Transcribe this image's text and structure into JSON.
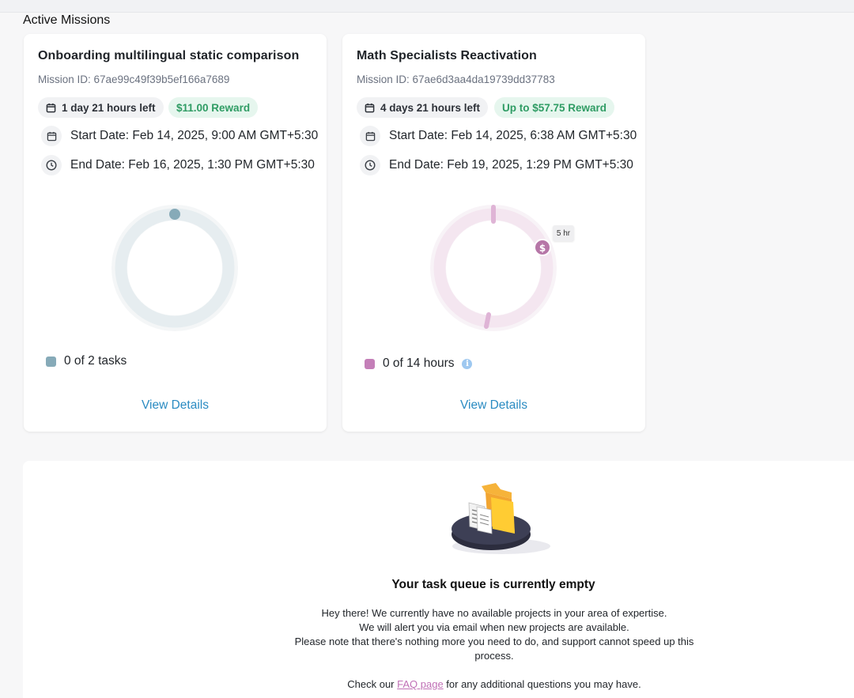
{
  "section_title": "Active Missions",
  "missions": [
    {
      "title": "Onboarding multilingual static comparison",
      "mission_id": "Mission ID: 67ae99c49f39b5ef166a7689",
      "time_left": "1 day 21 hours left",
      "reward": "$11.00 Reward",
      "start_date": "Start Date: Feb 14, 2025, 9:00 AM GMT+5:30",
      "end_date": "End Date: Feb 16, 2025, 1:30 PM GMT+5:30",
      "progress_label": "0 of 2 tasks",
      "progress_fraction": 0,
      "ring_color": "#e6edf0",
      "accent_color": "#86aab8",
      "view_details": "View Details"
    },
    {
      "title": "Math Specialists Reactivation",
      "mission_id": "Mission ID: 67ae6d3aa4da19739dd37783",
      "time_left": "4 days 21 hours left",
      "reward": "Up to $57.75 Reward",
      "start_date": "Start Date: Feb 14, 2025, 6:38 AM GMT+5:30",
      "end_date": "End Date: Feb 19, 2025, 1:29 PM GMT+5:30",
      "progress_label": "0 of 14 hours",
      "progress_fraction": 0,
      "bonus_marker_label": "5 hr",
      "bonus_marker_icon": "$",
      "ring_color": "#f4e6f0",
      "accent_color": "#c47fb8",
      "view_details": "View Details"
    }
  ],
  "empty_state": {
    "title": "Your task queue is currently empty",
    "line1": "Hey there! We currently have no available projects in your area of expertise.",
    "line2": "We will alert you via email when new projects are available.",
    "line3": "Please note that there's nothing more you need to do, and support cannot speed up this process.",
    "faq_prefix": "Check our ",
    "faq_link": "FAQ page",
    "faq_suffix": " for any additional questions you may have."
  },
  "colors": {
    "reward_green": "#2f9c64",
    "link_blue": "#2a8bc2",
    "faq_pink": "#c070b6"
  }
}
